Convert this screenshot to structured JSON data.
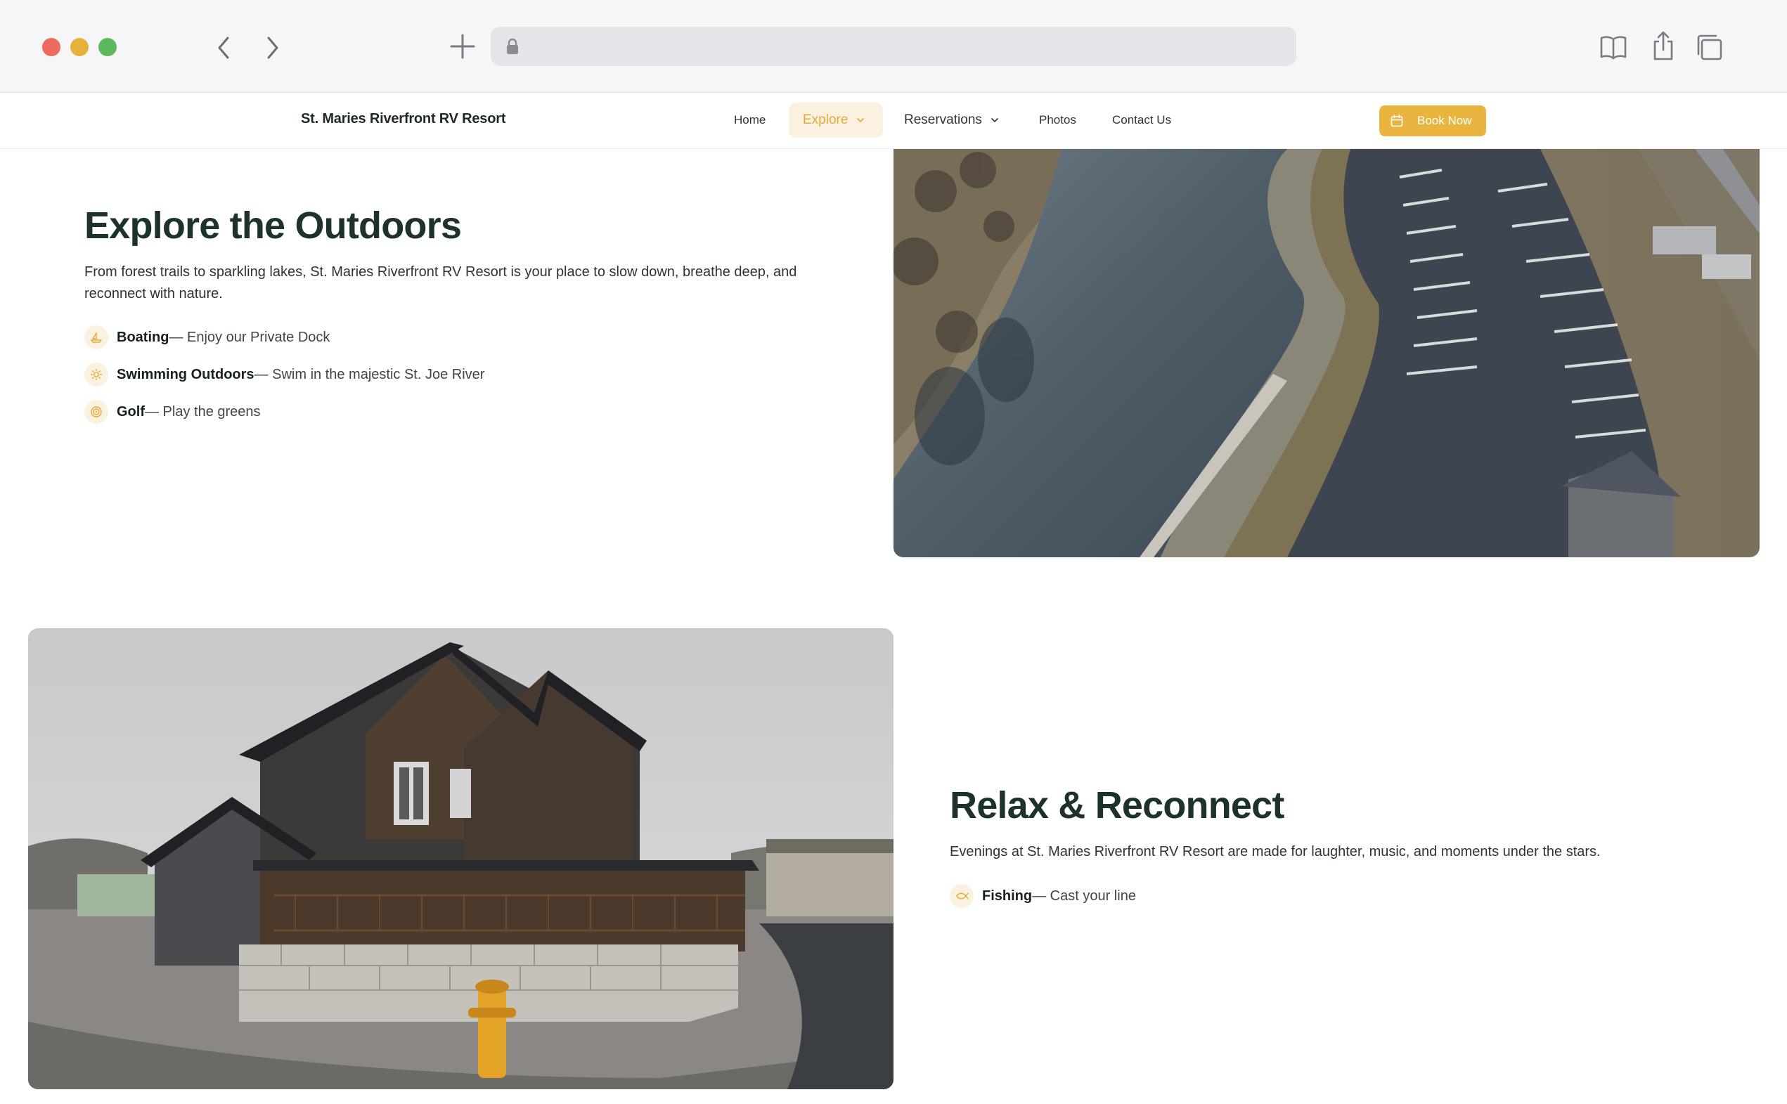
{
  "browser": {
    "icons": [
      "back-chevron-icon",
      "forward-chevron-icon",
      "plus-icon",
      "lock-icon",
      "book-icon",
      "share-icon",
      "tabs-icon"
    ]
  },
  "site": {
    "brand": "St. Maries Riverfront RV Resort",
    "nav": {
      "home": "Home",
      "explore": "Explore",
      "reservations": "Reservations",
      "photos": "Photos",
      "contact": "Contact Us"
    },
    "book_now": "Book Now",
    "accent_color": "#eab53f"
  },
  "section1": {
    "title": "Explore the Outdoors",
    "paragraph": "From forest trails to sparkling lakes, St. Maries Riverfront RV Resort is your place to slow down, breathe deep, and reconnect with nature.",
    "features": [
      {
        "name": "Boating",
        "desc": " — Enjoy our Private Dock",
        "icon": "boat-icon"
      },
      {
        "name": "Swimming Outdoors",
        "desc": " — Swim in the majestic St. Joe River",
        "icon": "sun-icon"
      },
      {
        "name": "Golf",
        "desc": " — Play the greens",
        "icon": "target-icon"
      }
    ]
  },
  "section2": {
    "title": "Relax & Reconnect",
    "paragraph": "Evenings at St. Maries Riverfront RV Resort are made for laughter, music, and moments under the stars.",
    "features": [
      {
        "name": "Fishing",
        "desc": " — Cast your line",
        "icon": "fish-icon"
      }
    ]
  }
}
